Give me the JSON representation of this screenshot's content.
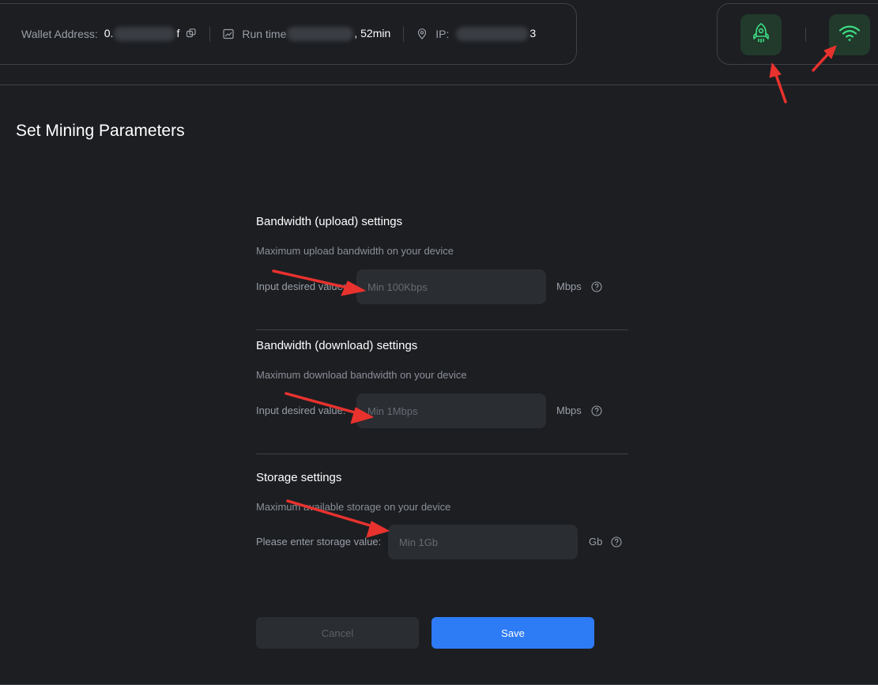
{
  "header": {
    "wallet_label": "Wallet Address:",
    "wallet_prefix": "0.",
    "wallet_suffix": "f",
    "runtime_label": "Run time",
    "runtime_suffix": ", 52min",
    "ip_label": "IP:",
    "ip_suffix": "3"
  },
  "icons": {
    "copy": "copy-icon",
    "runtime": "chart-icon",
    "ip": "location-pin-icon",
    "rocket": "rocket-icon",
    "wifi": "wifi-icon",
    "help": "question-circle-icon"
  },
  "page": {
    "title": "Set Mining Parameters"
  },
  "upload": {
    "title": "Bandwidth (upload) settings",
    "description": "Maximum upload bandwidth on your device",
    "label": "Input desired value:",
    "placeholder": "Min 100Kbps",
    "unit": "Mbps"
  },
  "download": {
    "title": "Bandwidth (download) settings",
    "description": "Maximum download bandwidth on your device",
    "label": "Input desired value:",
    "placeholder": "Min 1Mbps",
    "unit": "Mbps"
  },
  "storage": {
    "title": "Storage settings",
    "description": "Maximum available storage on your device",
    "label": "Please enter storage value:",
    "placeholder": "Min 1Gb",
    "unit": "Gb"
  },
  "actions": {
    "cancel_label": "Cancel",
    "save_label": "Save"
  },
  "colors": {
    "background": "#1c1e22",
    "accent_green": "#3ddc84",
    "status_bg": "#213a2b",
    "primary_blue": "#2e7bf6",
    "annotation_red": "#e8322e"
  }
}
